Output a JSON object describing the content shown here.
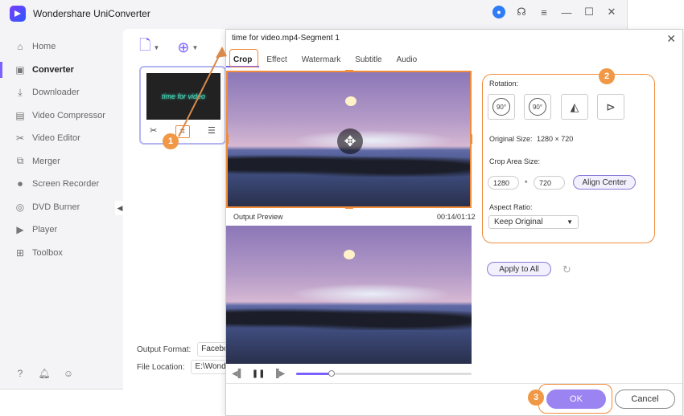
{
  "app": {
    "title": "Wondershare UniConverter"
  },
  "sidebar": {
    "items": [
      {
        "label": "Home",
        "icon": "home-icon"
      },
      {
        "label": "Converter",
        "icon": "converter-icon"
      },
      {
        "label": "Downloader",
        "icon": "downloader-icon"
      },
      {
        "label": "Video Compressor",
        "icon": "compress-icon"
      },
      {
        "label": "Video Editor",
        "icon": "scissors-icon"
      },
      {
        "label": "Merger",
        "icon": "merge-icon"
      },
      {
        "label": "Screen Recorder",
        "icon": "record-icon"
      },
      {
        "label": "DVD Burner",
        "icon": "disc-icon"
      },
      {
        "label": "Player",
        "icon": "play-icon"
      },
      {
        "label": "Toolbox",
        "icon": "grid-icon"
      }
    ],
    "active_index": 1
  },
  "content": {
    "thumbnail_text": "time for video",
    "output_format_label": "Output Format:",
    "output_format_value": "Facebook V",
    "file_location_label": "File Location:",
    "file_location_value": "E:\\Wonde"
  },
  "dialog": {
    "title": "time for video.mp4-Segment 1",
    "tabs": [
      "Crop",
      "Effect",
      "Watermark",
      "Subtitle",
      "Audio"
    ],
    "active_tab": "Crop",
    "output_preview_label": "Output Preview",
    "time": "00:14/01:12",
    "playback_progress": 0.2,
    "rotation_label": "Rotation:",
    "rotation_buttons": [
      "90°",
      "90°",
      "",
      ""
    ],
    "original_size_label": "Original Size:",
    "original_size_value": "1280 × 720",
    "crop_area_label": "Crop Area Size:",
    "crop_width": "1280",
    "crop_sep": "*",
    "crop_height": "720",
    "align_center": "Align Center",
    "aspect_ratio_label": "Aspect Ratio:",
    "aspect_ratio_value": "Keep Original",
    "apply_to_all": "Apply to All",
    "ok": "OK",
    "cancel": "Cancel"
  },
  "steps": [
    "1",
    "2",
    "3"
  ],
  "colors": {
    "accent": "#7b61ff",
    "highlight": "#f08c3a",
    "badge": "#f09846"
  }
}
